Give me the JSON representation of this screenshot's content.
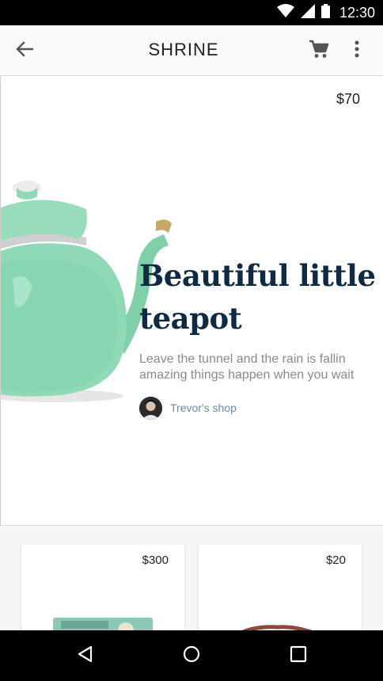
{
  "status_bar": {
    "time": "12:30"
  },
  "app_bar": {
    "title": "SHRINE"
  },
  "hero": {
    "price": "$70",
    "title": "Beautiful little teapot",
    "description": "Leave the tunnel and the rain is fallin amazing things happen when you wait",
    "shop_name": "Trevor's shop"
  },
  "products": [
    {
      "price": "$300"
    },
    {
      "price": "$20"
    }
  ],
  "colors": {
    "title": "#0f2a42",
    "teapot": "#8fd9b6",
    "shop_link": "#6f8aa4"
  }
}
